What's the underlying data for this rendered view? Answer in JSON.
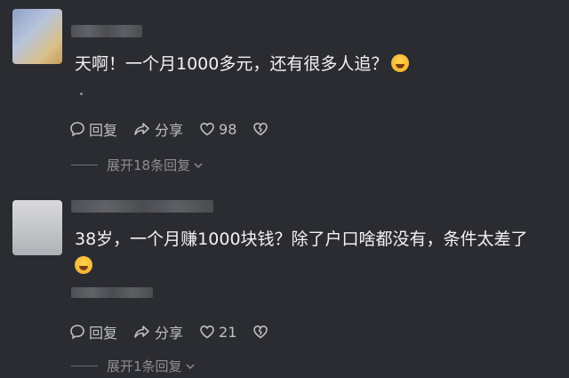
{
  "comments": [
    {
      "text": "天啊！一个月1000多元，还有很多人追？",
      "reply_label": "回复",
      "share_label": "分享",
      "like_count": "98",
      "replies_label": "展开18条回复"
    },
    {
      "text": "38岁，一个月赚1000块钱？除了户口啥都没有，条件太差了",
      "reply_label": "回复",
      "share_label": "分享",
      "like_count": "21",
      "replies_label": "展开1条回复"
    }
  ]
}
